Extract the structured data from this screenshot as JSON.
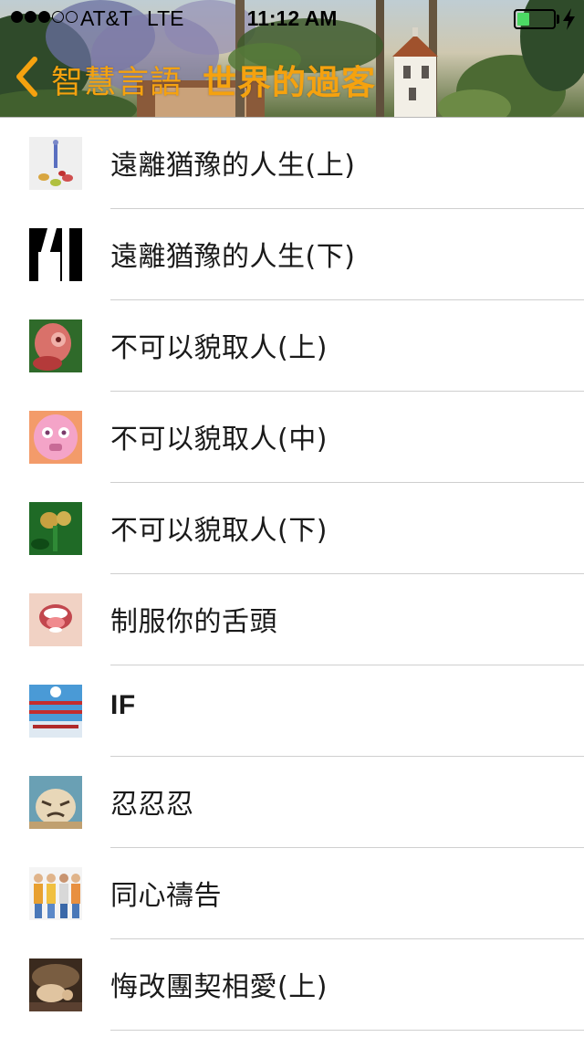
{
  "status_bar": {
    "signal_strength": "3 of 5",
    "carrier": "AT&T",
    "network": "LTE",
    "time": "11:12 AM",
    "battery_level": 0.35,
    "battery_color": "#4cd964",
    "charging_icon": "bolt-icon"
  },
  "nav": {
    "back_label": "智慧言語",
    "title": "世界的過客",
    "accent_color": "#f5a20f",
    "back_icon": "chevron-left-icon"
  },
  "list": {
    "items": [
      {
        "title": "遠離猶豫的人生(上)",
        "thumbnail": "figure-and-blocks-thumbnail"
      },
      {
        "title": "遠離猶豫的人生(下)",
        "thumbnail": "black-white-graphic-thumbnail"
      },
      {
        "title": "不可以貌取人(上)",
        "thumbnail": "red-figure-thumbnail"
      },
      {
        "title": "不可以貌取人(中)",
        "thumbnail": "pink-mask-thumbnail"
      },
      {
        "title": "不可以貌取人(下)",
        "thumbnail": "green-fruit-thumbnail"
      },
      {
        "title": "制服你的舌頭",
        "thumbnail": "open-mouth-thumbnail"
      },
      {
        "title": "IF",
        "thumbnail": "snowy-trees-thumbnail"
      },
      {
        "title": "忍忍忍",
        "thumbnail": "angry-face-thumbnail"
      },
      {
        "title": "同心禱告",
        "thumbnail": "people-group-thumbnail"
      },
      {
        "title": "悔改團契相愛(上)",
        "thumbnail": "kneeling-figure-thumbnail"
      }
    ]
  }
}
